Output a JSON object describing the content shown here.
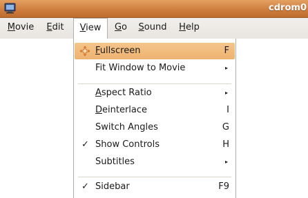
{
  "window": {
    "title": "cdrom0",
    "icon": "totem-app-icon"
  },
  "menubar": {
    "items": [
      {
        "label": "Movie"
      },
      {
        "label": "Edit"
      },
      {
        "label": "View"
      },
      {
        "label": "Go"
      },
      {
        "label": "Sound"
      },
      {
        "label": "Help"
      }
    ],
    "active_item": "View"
  },
  "view_menu": {
    "items": [
      {
        "label": "Fullscreen",
        "accelerator": "F",
        "icon": "fullscreen-icon",
        "highlighted": true
      },
      {
        "label": "Fit Window to Movie",
        "submenu": true
      },
      {
        "label": "Aspect Ratio",
        "submenu": true
      },
      {
        "label": "Deinterlace",
        "accelerator": "I"
      },
      {
        "label": "Switch Angles",
        "accelerator": "G"
      },
      {
        "label": "Show Controls",
        "accelerator": "H",
        "checked": true
      },
      {
        "label": "Subtitles",
        "submenu": true
      },
      {
        "label": "Sidebar",
        "accelerator": "F9",
        "checked": true
      }
    ],
    "check_mark": "✓",
    "submenu_arrow": "▸"
  },
  "colors": {
    "titlebar": "#cf7e3f",
    "highlight": "#f0b87a",
    "menubar_bg": "#ece9e4"
  }
}
